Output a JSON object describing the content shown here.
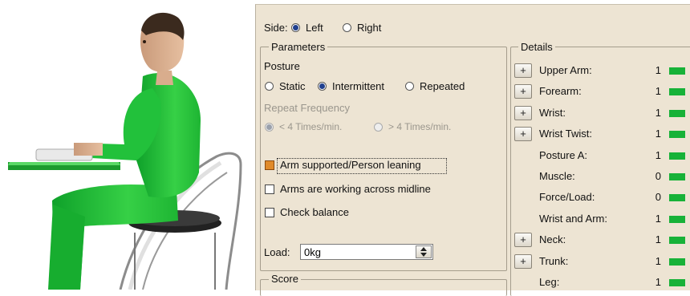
{
  "side": {
    "label": "Side:",
    "options": [
      {
        "label": "Left",
        "selected": true
      },
      {
        "label": "Right",
        "selected": false
      }
    ]
  },
  "parameters": {
    "legend": "Parameters",
    "posture_label": "Posture",
    "posture_options": [
      {
        "label": "Static",
        "selected": false
      },
      {
        "label": "Intermittent",
        "selected": true
      },
      {
        "label": "Repeated",
        "selected": false
      }
    ],
    "repeat_label": "Repeat Frequency",
    "repeat_options": [
      {
        "label": "< 4 Times/min.",
        "selected": true,
        "enabled": false
      },
      {
        "label": "> 4 Times/min.",
        "selected": false,
        "enabled": false
      }
    ],
    "checkboxes": [
      {
        "label": "Arm supported/Person leaning",
        "checked": true
      },
      {
        "label": "Arms are working across midline",
        "checked": false
      },
      {
        "label": "Check balance",
        "checked": false
      }
    ],
    "load_label": "Load:",
    "load_value": "0kg"
  },
  "score": {
    "legend": "Score"
  },
  "details": {
    "legend": "Details",
    "indicator_color": "#17b238",
    "rows": [
      {
        "label": "Upper Arm:",
        "value": "1",
        "expandable": true
      },
      {
        "label": "Forearm:",
        "value": "1",
        "expandable": true
      },
      {
        "label": "Wrist:",
        "value": "1",
        "expandable": true
      },
      {
        "label": "Wrist Twist:",
        "value": "1",
        "expandable": true
      },
      {
        "label": "Posture A:",
        "value": "1",
        "expandable": false
      },
      {
        "label": "Muscle:",
        "value": "0",
        "expandable": false
      },
      {
        "label": "Force/Load:",
        "value": "0",
        "expandable": false
      },
      {
        "label": "Wrist and Arm:",
        "value": "1",
        "expandable": false
      },
      {
        "label": "Neck:",
        "value": "1",
        "expandable": true
      },
      {
        "label": "Trunk:",
        "value": "1",
        "expandable": true
      },
      {
        "label": "Leg:",
        "value": "1",
        "expandable": false
      }
    ],
    "expand_label": "+"
  }
}
